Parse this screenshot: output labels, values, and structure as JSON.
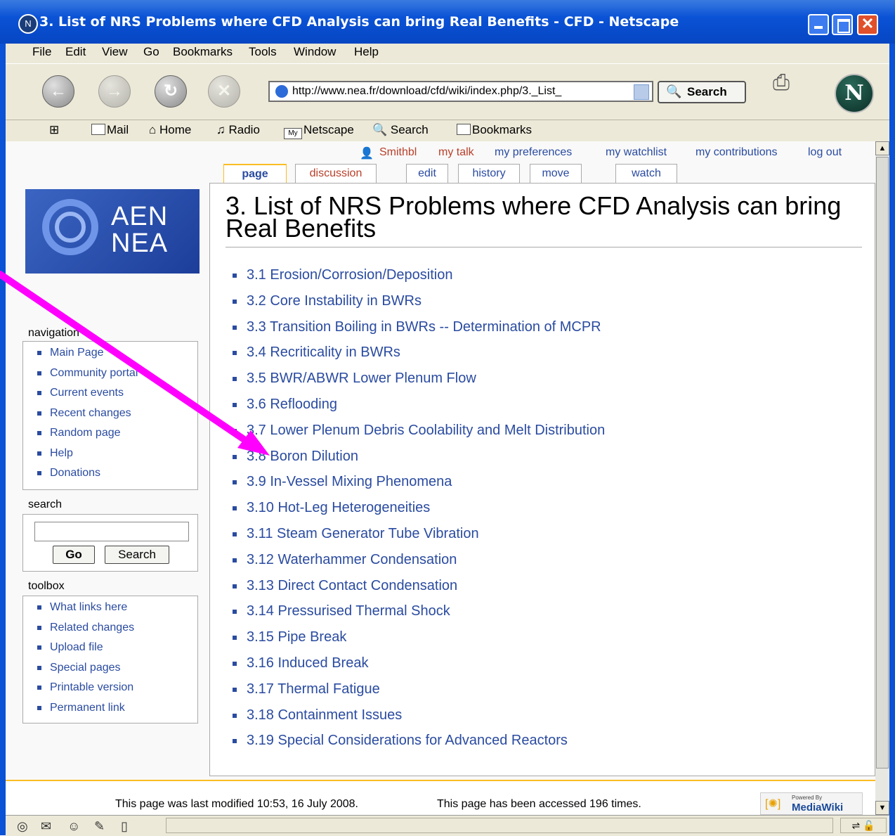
{
  "window": {
    "title": "3. List of NRS Problems where CFD Analysis can bring Real Benefits - CFD - Netscape",
    "app_icon": "netscape-icon"
  },
  "menu": [
    "File",
    "Edit",
    "View",
    "Go",
    "Bookmarks",
    "Tools",
    "Window",
    "Help"
  ],
  "navigation_bar": {
    "url": "http://www.nea.fr/download/cfd/wiki/index.php/3._List_",
    "search_button": "Search"
  },
  "personal_toolbar": [
    "Mail",
    "Home",
    "Radio",
    "Netscape",
    "Search",
    "Bookmarks"
  ],
  "personal_toolbar_badges": {
    "my_netscape": "My"
  },
  "user_tools": [
    "Smithbl",
    "my talk",
    "my preferences",
    "my watchlist",
    "my contributions",
    "log out"
  ],
  "tabs": [
    "page",
    "discussion",
    "edit",
    "history",
    "move",
    "watch"
  ],
  "logo": {
    "line1": "AEN",
    "line2": "NEA"
  },
  "sidebar": {
    "navigation_title": "navigation",
    "navigation": [
      "Main Page",
      "Community portal",
      "Current events",
      "Recent changes",
      "Random page",
      "Help",
      "Donations"
    ],
    "search_title": "search",
    "search_go": "Go",
    "search_button": "Search",
    "toolbox_title": "toolbox",
    "toolbox": [
      "What links here",
      "Related changes",
      "Upload file",
      "Special pages",
      "Printable version",
      "Permanent link"
    ]
  },
  "article": {
    "title": "3. List of NRS Problems where CFD Analysis can bring Real Benefits",
    "items": [
      "3.1 Erosion/Corrosion/Deposition",
      "3.2 Core Instability in BWRs",
      "3.3 Transition Boiling in BWRs -- Determination of MCPR",
      "3.4 Recriticality in BWRs",
      "3.5 BWR/ABWR Lower Plenum Flow",
      "3.6 Reflooding",
      "3.7 Lower Plenum Debris Coolability and Melt Distribution",
      "3.8 Boron Dilution",
      "3.9 In-Vessel Mixing Phenomena",
      "3.10 Hot-Leg Heterogeneities",
      "3.11 Steam Generator Tube Vibration",
      "3.12 Waterhammer Condensation",
      "3.13 Direct Contact Condensation",
      "3.14 Pressurised Thermal Shock",
      "3.15 Pipe Break",
      "3.16 Induced Break",
      "3.17 Thermal Fatigue",
      "3.18 Containment Issues",
      "3.19 Special Considerations for Advanced Reactors"
    ]
  },
  "footer": {
    "last_modified": "This page was last modified 10:53, 16 July 2008.",
    "access_count": "This page has been accessed 196 times.",
    "badge_top": "Powered By",
    "badge_name": "MediaWiki"
  },
  "colors": {
    "titlebar": "#0a52d6",
    "link": "#2a4ba0",
    "annotation_arrow": "#ff00ff",
    "tab_highlight": "#fabd23"
  }
}
